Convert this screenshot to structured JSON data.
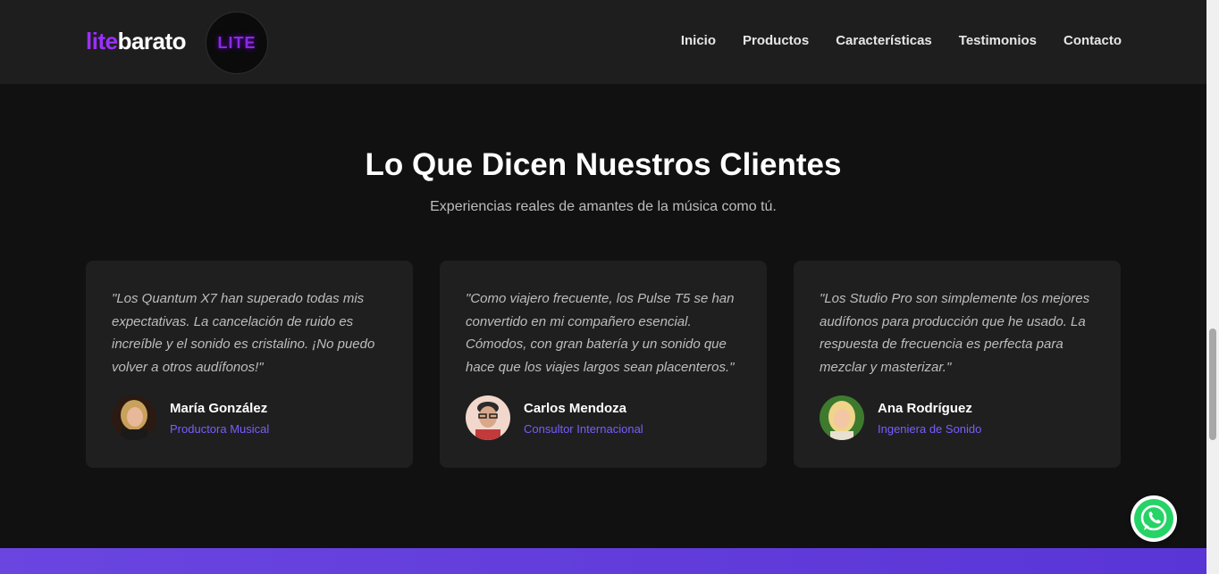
{
  "header": {
    "brand_lite": "lite",
    "brand_barato": "barato",
    "badge": "LITE",
    "nav": [
      "Inicio",
      "Productos",
      "Características",
      "Testimonios",
      "Contacto"
    ]
  },
  "section": {
    "title": "Lo Que Dicen Nuestros Clientes",
    "subtitle": "Experiencias reales de amantes de la música como tú."
  },
  "testimonials": [
    {
      "quote": "\"Los Quantum X7 han superado todas mis expectativas. La cancelación de ruido es increíble y el sonido es cristalino. ¡No puedo volver a otros audífonos!\"",
      "name": "María González",
      "role": "Productora Musical"
    },
    {
      "quote": "\"Como viajero frecuente, los Pulse T5 se han convertido en mi compañero esencial. Cómodos, con gran batería y un sonido que hace que los viajes largos sean placenteros.\"",
      "name": "Carlos Mendoza",
      "role": "Consultor Internacional"
    },
    {
      "quote": "\"Los Studio Pro son simplemente los mejores audífonos para producción que he usado. La respuesta de frecuencia es perfecta para mezclar y masterizar.\"",
      "name": "Ana Rodríguez",
      "role": "Ingeniera de Sonido"
    }
  ],
  "colors": {
    "accent": "#9b30ff",
    "role": "#7b5cff",
    "footer": "#6a45e0"
  },
  "icons": {
    "whatsapp": "whatsapp-icon"
  }
}
